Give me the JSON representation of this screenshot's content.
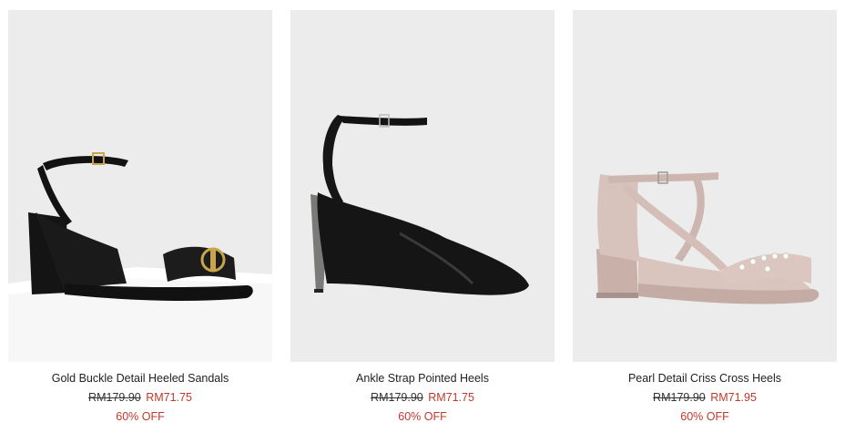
{
  "products": [
    {
      "name": "Gold Buckle Detail Heeled Sandals",
      "original_price": "RM179.90",
      "sale_price": "RM71.75",
      "discount": "60% OFF",
      "image_icon": "black-buckle-sandal-image"
    },
    {
      "name": "Ankle Strap Pointed Heels",
      "original_price": "RM179.90",
      "sale_price": "RM71.75",
      "discount": "60% OFF",
      "image_icon": "black-pointed-heel-image"
    },
    {
      "name": "Pearl Detail Criss Cross Heels",
      "original_price": "RM179.90",
      "sale_price": "RM71.95",
      "discount": "60% OFF",
      "image_icon": "nude-pearl-sandal-image"
    }
  ],
  "colors": {
    "image_background": "#ececec",
    "sale_red": "#c0392b",
    "text": "#222222"
  }
}
